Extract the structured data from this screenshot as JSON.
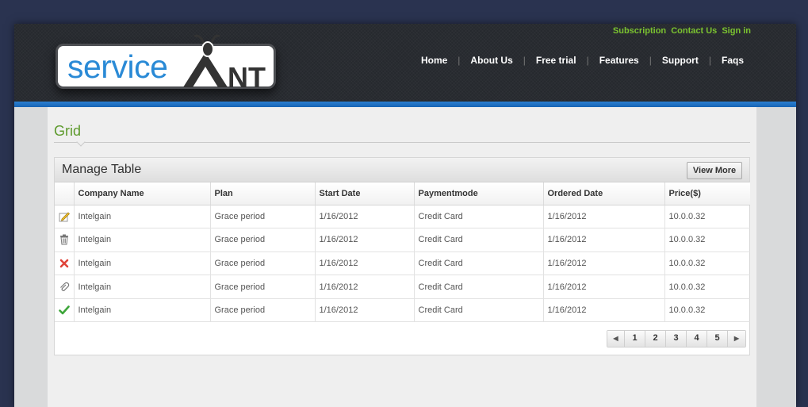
{
  "brand": {
    "logo_text": "service",
    "logo_mark_text": "NT",
    "logo_color": "#2a8ad6"
  },
  "top_links": [
    "Subscription",
    "Contact Us",
    "Sign in"
  ],
  "nav": [
    "Home",
    "About Us",
    "Free trial",
    "Features",
    "Support",
    "Faqs"
  ],
  "page": {
    "title": "Grid"
  },
  "panel": {
    "title": "Manage Table",
    "view_more_label": "View More"
  },
  "table": {
    "columns": [
      "",
      "Company Name",
      "Plan",
      "Start Date",
      "Paymentmode",
      "Ordered Date",
      "Price($)"
    ],
    "rows": [
      {
        "icon": "edit-icon",
        "company": "Intelgain",
        "plan": "Grace period",
        "start": "1/16/2012",
        "payment": "Credit Card",
        "ordered": "1/16/2012",
        "price": "10.0.0.32"
      },
      {
        "icon": "trash-icon",
        "company": "Intelgain",
        "plan": "Grace period",
        "start": "1/16/2012",
        "payment": "Credit Card",
        "ordered": "1/16/2012",
        "price": "10.0.0.32"
      },
      {
        "icon": "close-icon",
        "company": "Intelgain",
        "plan": "Grace period",
        "start": "1/16/2012",
        "payment": "Credit Card",
        "ordered": "1/16/2012",
        "price": "10.0.0.32"
      },
      {
        "icon": "attachment-icon",
        "company": "Intelgain",
        "plan": "Grace period",
        "start": "1/16/2012",
        "payment": "Credit Card",
        "ordered": "1/16/2012",
        "price": "10.0.0.32"
      },
      {
        "icon": "check-icon",
        "company": "Intelgain",
        "plan": "Grace period",
        "start": "1/16/2012",
        "payment": "Credit Card",
        "ordered": "1/16/2012",
        "price": "10.0.0.32"
      }
    ]
  },
  "pagination": {
    "prev_icon": "chevron-left-icon",
    "next_icon": "chevron-right-icon",
    "pages": [
      "1",
      "2",
      "3",
      "4",
      "5"
    ]
  },
  "colors": {
    "accent_green": "#7bc330",
    "title_green": "#5d9a2c",
    "header_blue": "#1764b5"
  }
}
